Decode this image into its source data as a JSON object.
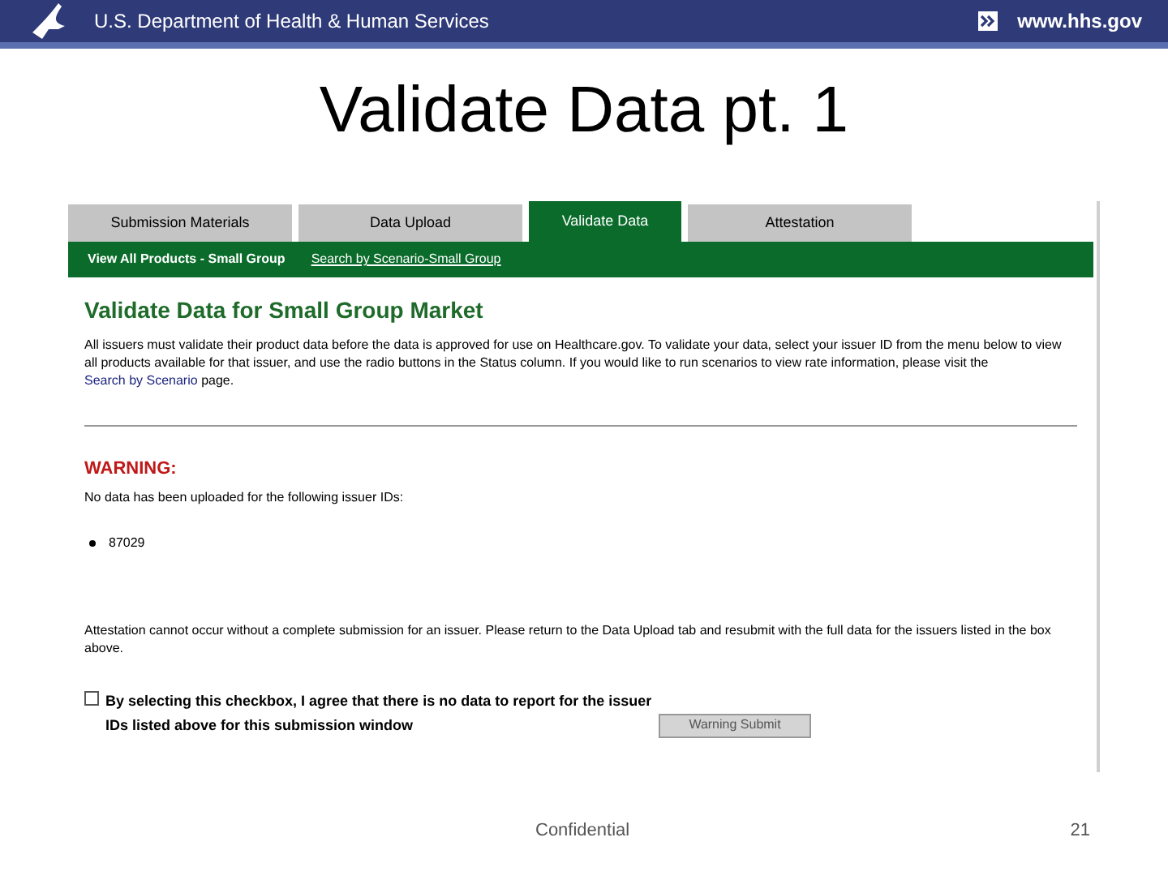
{
  "banner": {
    "agency": "U.S. Department of Health & Human Services",
    "link": "www.hhs.gov"
  },
  "slide_title": "Validate Data pt. 1",
  "tabs": [
    {
      "label": "Submission Materials",
      "selected": false
    },
    {
      "label": "Data Upload",
      "selected": false
    },
    {
      "label": "Validate Data",
      "selected": true
    },
    {
      "label": "Attestation",
      "selected": false
    }
  ],
  "subnav": [
    {
      "label": "View All Products - Small Group",
      "selected": true
    },
    {
      "label": "Search by Scenario-Small Group",
      "selected": false
    }
  ],
  "heading": "Validate Data for Small Group Market",
  "intro": {
    "text": "All issuers must validate their product data before the data is approved for use on Healthcare.gov. To validate your data, select your issuer ID from the menu below to view all products available for that issuer, and use the radio buttons in the Status column. If you would like to run scenarios to view rate information, please visit the",
    "link": "Search by Scenario",
    "after": "page."
  },
  "warning": {
    "title": "WARNING:",
    "text": "No data has been uploaded for the following issuer IDs:",
    "issuers": [
      "87029"
    ]
  },
  "attestation_note": "Attestation cannot occur without a complete submission for an issuer. Please return to the Data Upload tab and resubmit with the full data for the issuers listed in the box above.",
  "agree": {
    "label": "By selecting this checkbox, I agree that there is no data to report for the issuer IDs listed above for this submission window",
    "checked": false
  },
  "submit": {
    "label": "Warning Submit",
    "disabled": true
  },
  "footer": {
    "note": "Confidential",
    "page": "21"
  }
}
